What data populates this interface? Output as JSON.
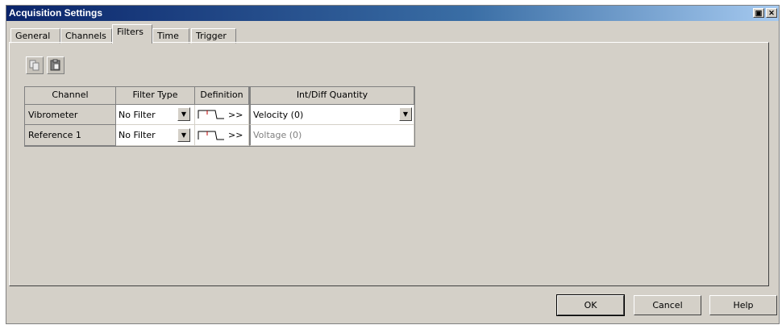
{
  "window": {
    "title": "Acquisition Settings"
  },
  "title_buttons": {
    "restore": "▣",
    "close": "✕"
  },
  "tabs": [
    {
      "label": "General"
    },
    {
      "label": "Channels"
    },
    {
      "label": "Filters"
    },
    {
      "label": "Time"
    },
    {
      "label": "Trigger"
    }
  ],
  "active_tab": "Filters",
  "table": {
    "headers": [
      "Channel",
      "Filter Type",
      "Definition",
      "Int/Diff Quantity"
    ],
    "rows": [
      {
        "channel": "Vibrometer",
        "filter_type": "No Filter",
        "definition": ">>",
        "quantity": "Velocity (0)"
      },
      {
        "channel": "Reference 1",
        "filter_type": "No Filter",
        "definition": ">>",
        "quantity": "Voltage (0)"
      }
    ]
  },
  "buttons": {
    "ok": "OK",
    "cancel": "Cancel",
    "help": "Help"
  },
  "colors": {
    "face": "#d4d0c8",
    "title_start": "#0a246a",
    "title_end": "#a6caf0",
    "disabled_text": "#808080"
  }
}
